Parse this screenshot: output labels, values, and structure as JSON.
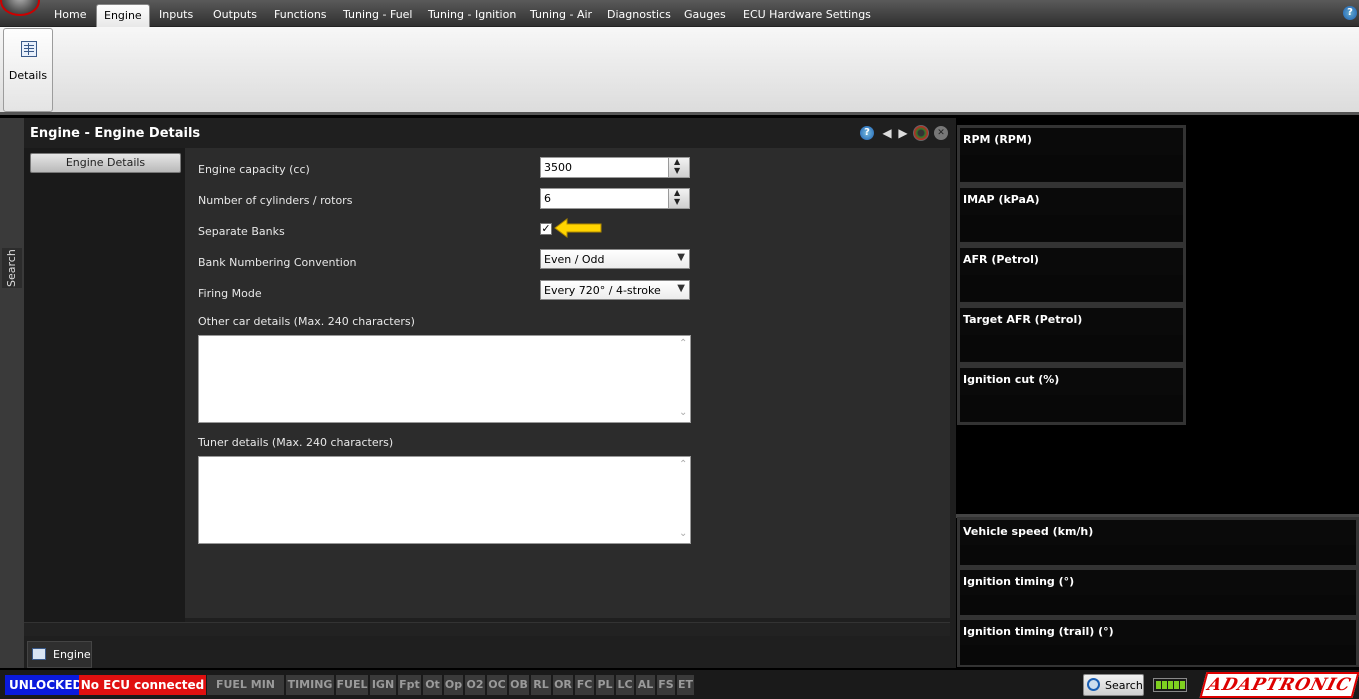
{
  "ribbon": {
    "tabs": [
      "Home",
      "Engine",
      "Inputs",
      "Outputs",
      "Functions",
      "Tuning - Fuel",
      "Tuning - Ignition",
      "Tuning - Air",
      "Diagnostics",
      "Gauges",
      "ECU Hardware Settings"
    ],
    "active_tab": "Engine",
    "details_label": "Details",
    "help_glyph": "?"
  },
  "side": {
    "search_label": "Search"
  },
  "window": {
    "title": "Engine - Engine Details",
    "help_glyph": "?",
    "nav_item": "Engine Details",
    "fields": {
      "capacity_label": "Engine capacity (cc)",
      "capacity_value": "3500",
      "cylinders_label": "Number of cylinders / rotors",
      "cylinders_value": "6",
      "separate_banks_label": "Separate Banks",
      "separate_banks_checked": true,
      "bank_numbering_label": "Bank Numbering Convention",
      "bank_numbering_value": "Even / Odd",
      "firing_mode_label": "Firing Mode",
      "firing_mode_value": "Every 720° / 4-stroke",
      "other_details_label": "Other car details (Max. 240 characters)",
      "other_details_value": "",
      "tuner_details_label": "Tuner details (Max. 240 characters)",
      "tuner_details_value": ""
    },
    "bottom_tab": "Engine"
  },
  "gauges": {
    "top": [
      "RPM (RPM)",
      "IMAP  (kPaA)",
      "AFR (Petrol)",
      "Target AFR (Petrol)",
      "Ignition cut (%)"
    ],
    "bottom": [
      "Vehicle speed (km/h)",
      "Ignition timing (°)",
      "Ignition timing (trail) (°)"
    ]
  },
  "status": {
    "unlocked": "UNLOCKED",
    "ecu": "No ECU connected",
    "indicators": [
      "FUEL MIN PW",
      "TIMING",
      "FUEL",
      "IGN",
      "Fpt",
      "Ot",
      "Op",
      "O2",
      "OC",
      "OB",
      "RL",
      "OR",
      "FC",
      "PL",
      "LC",
      "AL",
      "FS",
      "ET"
    ],
    "search_label": "Search",
    "logo_text": "ADAPTRONIC"
  },
  "icons": {
    "details": "table-icon",
    "prev": "chevron-left-icon",
    "next": "chevron-right-icon",
    "gauge": "gauge-icon",
    "close": "close-icon",
    "arrow": "arrow-left-icon",
    "battery": "battery-icon"
  },
  "colors": {
    "unlocked_bg": "#0a1adc",
    "ecu_bg": "#e01010",
    "arrow": "#ffd400",
    "accent_logo": "#dd0000"
  }
}
